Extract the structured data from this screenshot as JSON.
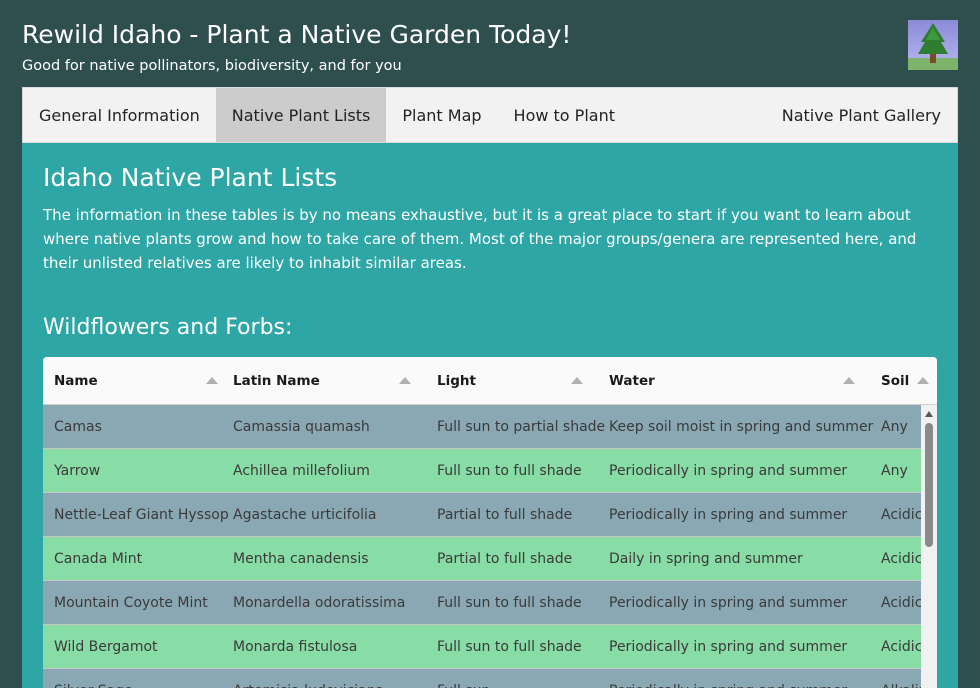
{
  "header": {
    "title": "Rewild Idaho - Plant a Native Garden Today!",
    "subtitle": "Good for native pollinators, biodiversity, and for you"
  },
  "nav": {
    "items": [
      {
        "label": "General Information"
      },
      {
        "label": "Native Plant Lists",
        "active": true
      },
      {
        "label": "Plant Map"
      },
      {
        "label": "How to Plant"
      },
      {
        "label": "Native Plant Gallery"
      }
    ]
  },
  "main": {
    "heading": "Idaho Native Plant Lists",
    "intro": "The information in these tables is by no means exhaustive, but it is a great place to start if you want to learn about where native plants grow and how to take care of them. Most of the major groups/genera are represented here, and their unlisted relatives are likely to inhabit similar areas.",
    "section_heading": "Wildflowers and Forbs:"
  },
  "table": {
    "columns": [
      "Name",
      "Latin Name",
      "Light",
      "Water",
      "Soil"
    ],
    "rows": [
      [
        "Camas",
        "Camassia quamash",
        "Full sun to partial shade",
        "Keep soil moist in spring and summer",
        "Any"
      ],
      [
        "Yarrow",
        "Achillea millefolium",
        "Full sun to full shade",
        "Periodically in spring and summer",
        "Any"
      ],
      [
        "Nettle-Leaf Giant Hyssop",
        "Agastache urticifolia",
        "Partial to full shade",
        "Periodically in spring and summer",
        "Acidic"
      ],
      [
        "Canada Mint",
        "Mentha canadensis",
        "Partial to full shade",
        "Daily in spring and summer",
        "Acidic"
      ],
      [
        "Mountain Coyote Mint",
        "Monardella odoratissima",
        "Full sun to full shade",
        "Periodically in spring and summer",
        "Acidic"
      ],
      [
        "Wild Bergamot",
        "Monarda fistulosa",
        "Full sun to full shade",
        "Periodically in spring and summer",
        "Acidic"
      ],
      [
        "Silver Sage",
        "Artemisia ludoviciana",
        "Full sun",
        "Periodically in spring and summer",
        "Alkaline"
      ]
    ]
  },
  "colors": {
    "background": "#2f4f4f",
    "main_panel": "#2fa6a6",
    "row_even": "#8aa8b4",
    "row_odd": "#88dca5"
  },
  "icons": {
    "logo": "tree-logo-icon",
    "sort": "sort-arrow-icon"
  }
}
